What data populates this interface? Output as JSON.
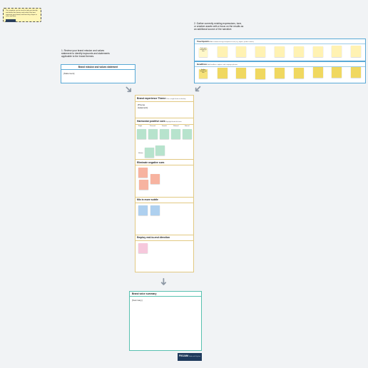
{
  "top_note": {
    "text": "This template can be used to help you identify and define the themes and values that best represent your brand, and how they shape its voice and tone.",
    "button": ""
  },
  "step1": {
    "instruction": "1. Review your brand mission and values statement to identify keywords and statements applicable to the brand themes."
  },
  "step2": {
    "instruction": "2. Gather currently existing expressions, tone, or creative assets with a focus on the results as an additional source of the narrative."
  },
  "mission_card": {
    "title": "Brand mission and values statement",
    "body": "[Statement]"
  },
  "touchpoints": {
    "title": "Touchpoints",
    "subtitle": "Add customer-facing touchpoints to sort (e.g. tagline, product names)",
    "label_note": "Touch- point examples go here"
  },
  "headlines": {
    "title": "Headlines",
    "subtitle": "Add headlines, taglines, and campaign phrases",
    "label_note": "Headline examples go here"
  },
  "board": {
    "brand_theme": {
      "title": "Brand experience Theme",
      "subtitle": "Pick a single theme to develop",
      "body": "[Theme statement]"
    },
    "positive": {
      "title": "Harmonize positive cues",
      "subtitle": "Highlight brand-led voice",
      "labels": [
        "Bright",
        "Personal",
        "Smooth",
        "Relaxed",
        "Natural"
      ],
      "extra_label": "Modern"
    },
    "negative": {
      "title": "Eliminate negative cues"
    },
    "mix": {
      "title": "Mix in more subtle"
    },
    "employ": {
      "title": "Employ end-to-end direction"
    }
  },
  "summary": {
    "title": "Brand voice summary",
    "body": "[Summary]"
  },
  "logo": {
    "name": "FIGJAM",
    "tagline": "Made with FigJam"
  },
  "colors": {
    "yellow_sticky": "#fff2b3",
    "yellow_dark": "#f0d860",
    "green_sticky": "#b7e3cd",
    "red_sticky": "#f7b3a0",
    "blue_sticky": "#aed0ef",
    "pink_sticky": "#f6c8dc",
    "accent_blue": "#5aa9d6",
    "accent_teal": "#58c1b0",
    "board_border": "#e2c983",
    "logo_bg": "#1f3a5c"
  }
}
